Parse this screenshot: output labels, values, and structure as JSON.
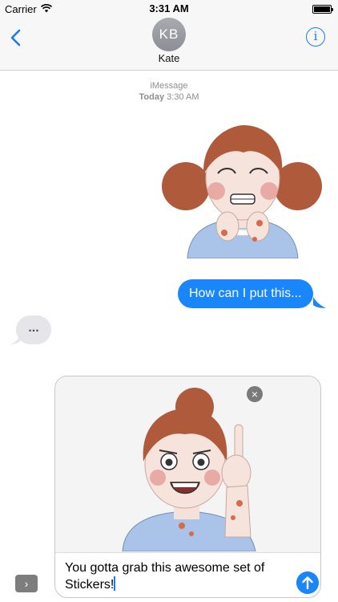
{
  "status_bar": {
    "carrier": "Carrier",
    "time": "3:31 AM",
    "battery_level": 1.0
  },
  "nav": {
    "avatar_initials": "KB",
    "contact_name": "Kate",
    "info_label": "i"
  },
  "thread": {
    "service": "iMessage",
    "date_day": "Today",
    "date_time": "3:30 AM",
    "outgoing_text": "How can I put this...",
    "typing_indicator": "..."
  },
  "compose": {
    "expand_label": "›",
    "remove_label": "×",
    "text": "You gotta grab this awesome set of Stickers!"
  },
  "colors": {
    "accent": "#1a86fb",
    "incoming_bubble": "#e5e5ea",
    "avatar": "#9a9ca3"
  },
  "icons": [
    "wifi-icon",
    "battery-icon",
    "chevron-left-icon",
    "info-icon",
    "close-icon",
    "chevron-right-icon",
    "arrow-up-icon"
  ]
}
